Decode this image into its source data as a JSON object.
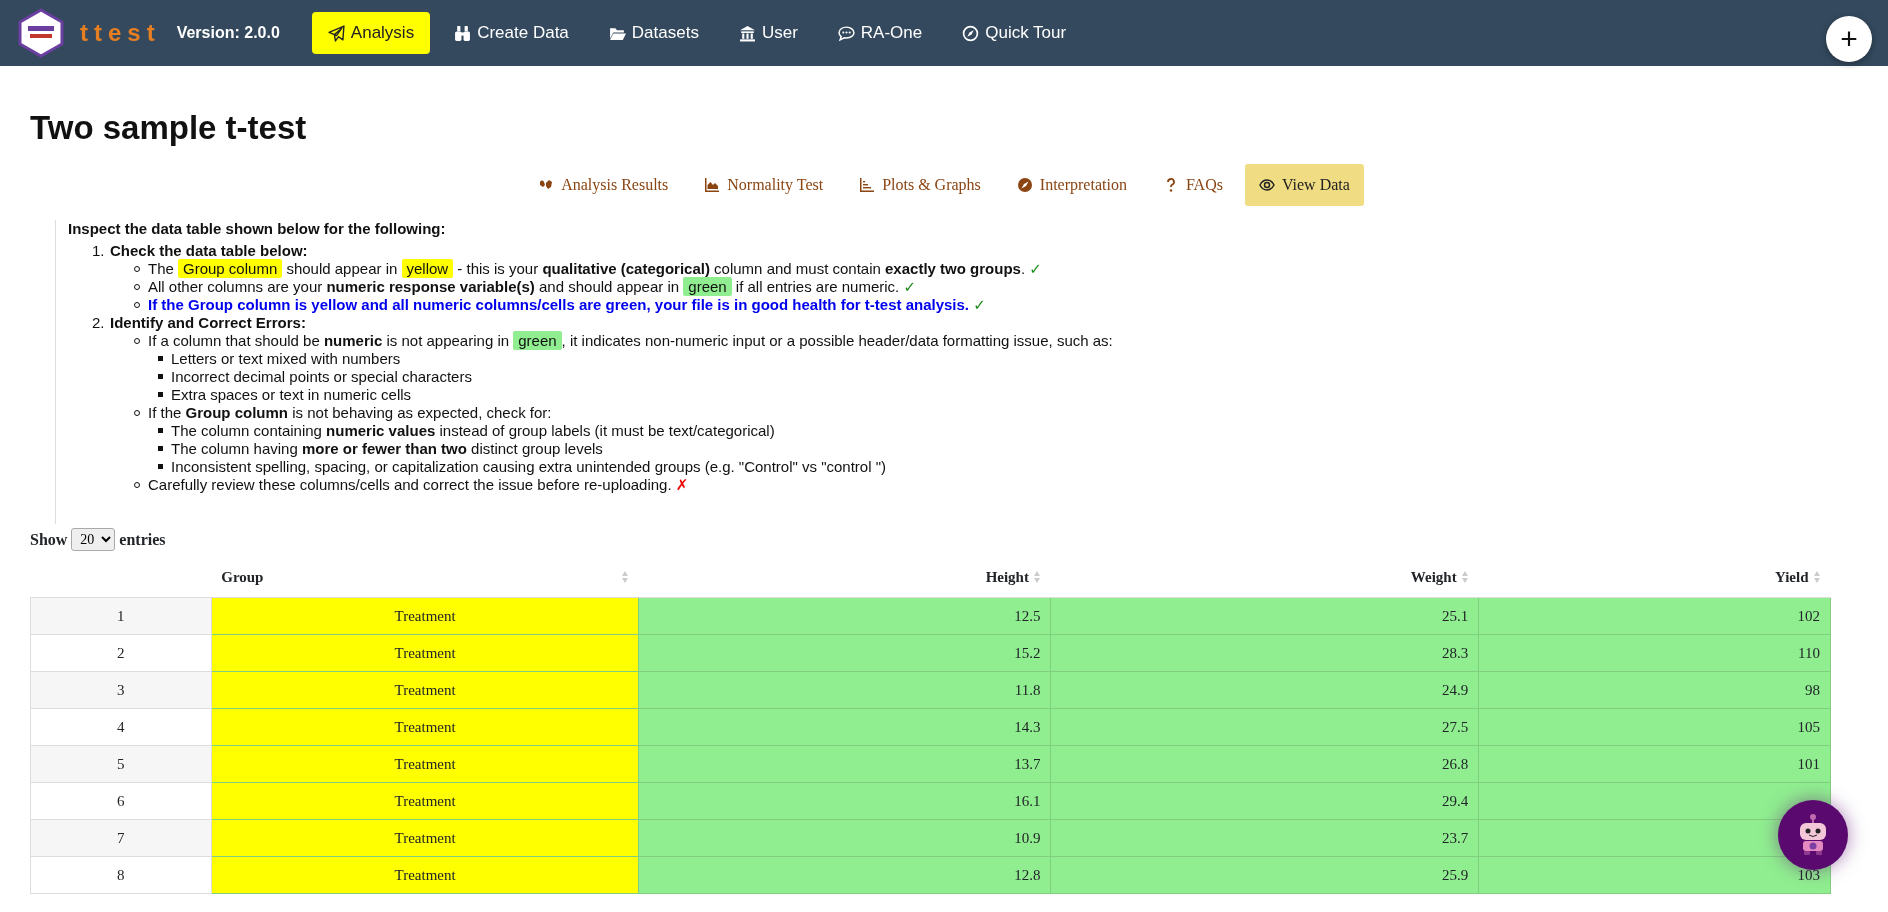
{
  "navbar": {
    "app_name": "ttest",
    "version": "Version: 2.0.0",
    "items": [
      {
        "label": "Analysis",
        "selected": true
      },
      {
        "label": "Create Data",
        "selected": false
      },
      {
        "label": "Datasets",
        "selected": false
      },
      {
        "label": "User",
        "selected": false
      },
      {
        "label": "RA-One",
        "selected": false
      },
      {
        "label": "Quick Tour",
        "selected": false
      }
    ]
  },
  "add_button": "+",
  "title": "Two sample t-test",
  "tabs": [
    {
      "label": "Analysis Results",
      "selected": false
    },
    {
      "label": "Normality Test",
      "selected": false
    },
    {
      "label": "Plots & Graphs",
      "selected": false
    },
    {
      "label": "Interpretation",
      "selected": false
    },
    {
      "label": "FAQs",
      "selected": false
    },
    {
      "label": "View Data",
      "selected": true
    }
  ],
  "instructions": {
    "intro": "Inspect the data table shown below for the following:",
    "steps": [
      {
        "number": "1.",
        "title": "Check the data table below:",
        "items": [
          {
            "kind": "plain",
            "segments": [
              {
                "text": "The "
              },
              {
                "text": "Group column",
                "kind": "mark-yellow"
              },
              {
                "text": " should appear in "
              },
              {
                "text": "yellow",
                "kind": "mark-yellow"
              },
              {
                "text": " - this is your **qualitative (categorical)** column and must contain **exactly two groups**. "
              },
              {
                "text": "✓",
                "kind": "check"
              }
            ]
          },
          {
            "kind": "plain",
            "segments": [
              {
                "text": "All other columns are your **numeric response variable(s)** and should appear in "
              },
              {
                "text": "green",
                "kind": "mark-green"
              },
              {
                "text": " if all entries are numeric. "
              },
              {
                "text": "✓",
                "kind": "check"
              }
            ]
          },
          {
            "kind": "note",
            "segments": [
              {
                "text": "If the Group column is yellow and all numeric columns/cells are green, your file is in good health for t-test analysis. "
              },
              {
                "text": "✓",
                "kind": "check"
              }
            ]
          }
        ]
      },
      {
        "number": "2.",
        "title": "Identify and Correct Errors:",
        "items": [
          {
            "kind": "plain",
            "segments": [
              {
                "text": "If a column that should be **numeric** is not appearing in "
              },
              {
                "text": "green",
                "kind": "mark-green"
              },
              {
                "text": ", it indicates non-numeric input or a possible header/data formatting issue, such as:"
              }
            ],
            "children": [
              "Letters or text mixed with numbers",
              "Incorrect decimal points or special characters",
              "Extra spaces or text in numeric cells"
            ]
          },
          {
            "kind": "plain",
            "segments": [
              {
                "text": "If the **Group column** is not behaving as expected, check for:"
              }
            ],
            "children": [
              "The column containing **numeric values** instead of group labels (it must be text/categorical)",
              "The column having **more or fewer than two** distinct group levels",
              "Inconsistent spelling, spacing, or capitalization causing extra unintended groups (e.g. \"Control\" vs \"control \")"
            ]
          },
          {
            "kind": "plain",
            "segments": [
              {
                "text": "Carefully review these columns/cells and correct the issue before re-uploading. "
              },
              {
                "text": "✗",
                "kind": "cross"
              }
            ]
          }
        ]
      }
    ]
  },
  "entries": {
    "before": "Show",
    "value": "20",
    "after": "entries"
  },
  "table": {
    "columns": [
      {
        "label": "Group",
        "color": "#ffff00",
        "kind": "text"
      },
      {
        "label": "Height",
        "color": "#90ee90",
        "kind": "number"
      },
      {
        "label": "Weight",
        "color": "#90ee90",
        "kind": "number"
      },
      {
        "label": "Yield",
        "color": "#90ee90",
        "kind": "number"
      }
    ],
    "rows": [
      {
        "index": "1",
        "cells": [
          "Treatment",
          "12.5",
          "25.1",
          "102"
        ]
      },
      {
        "index": "2",
        "cells": [
          "Treatment",
          "15.2",
          "28.3",
          "110"
        ]
      },
      {
        "index": "3",
        "cells": [
          "Treatment",
          "11.8",
          "24.9",
          "98"
        ]
      },
      {
        "index": "4",
        "cells": [
          "Treatment",
          "14.3",
          "27.5",
          "105"
        ]
      },
      {
        "index": "5",
        "cells": [
          "Treatment",
          "13.7",
          "26.8",
          "101"
        ]
      },
      {
        "index": "6",
        "cells": [
          "Treatment",
          "16.1",
          "29.4"
        ]
      },
      {
        "index": "7",
        "cells": [
          "Treatment",
          "10.9",
          "23.7"
        ]
      },
      {
        "index": "8",
        "cells": [
          "Treatment",
          "12.8",
          "25.9",
          "103"
        ]
      }
    ]
  }
}
